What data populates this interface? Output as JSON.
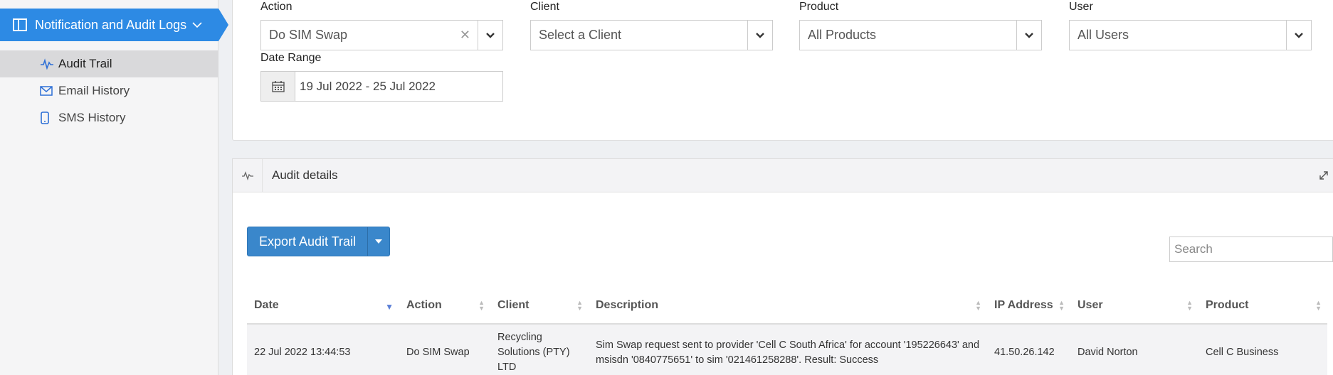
{
  "sidebar": {
    "section_title": "Notification and Audit Logs",
    "items": [
      {
        "label": "Audit Trail",
        "icon": "activity-icon"
      },
      {
        "label": "Email History",
        "icon": "envelope-icon"
      },
      {
        "label": "SMS History",
        "icon": "mobile-icon"
      }
    ]
  },
  "filters": {
    "action": {
      "label": "Action",
      "value": "Do SIM Swap"
    },
    "client": {
      "label": "Client",
      "value": "Select a Client"
    },
    "product": {
      "label": "Product",
      "value": "All Products"
    },
    "user": {
      "label": "User",
      "value": "All Users"
    },
    "date_range": {
      "label": "Date Range",
      "value": "19 Jul 2022 - 25 Jul 2022"
    }
  },
  "audit": {
    "title": "Audit details",
    "export_label": "Export Audit Trail",
    "search_placeholder": "Search",
    "columns": [
      "Date",
      "Action",
      "Client",
      "Description",
      "IP Address",
      "User",
      "Product"
    ],
    "rows": [
      {
        "date": "22 Jul 2022 13:44:53",
        "action": "Do SIM Swap",
        "client": "Recycling Solutions (PTY) LTD",
        "description": "Sim Swap request sent to provider 'Cell C South Africa' for account '195226643' and msisdn '0840775651' to sim '021461258288'. Result: Success",
        "ip": "41.50.26.142",
        "user": "David Norton",
        "product": "Cell C Business"
      }
    ]
  },
  "colors": {
    "accent": "#2d8ae4",
    "button": "#3a87cb",
    "sidebar_active": "#d9d9db"
  }
}
